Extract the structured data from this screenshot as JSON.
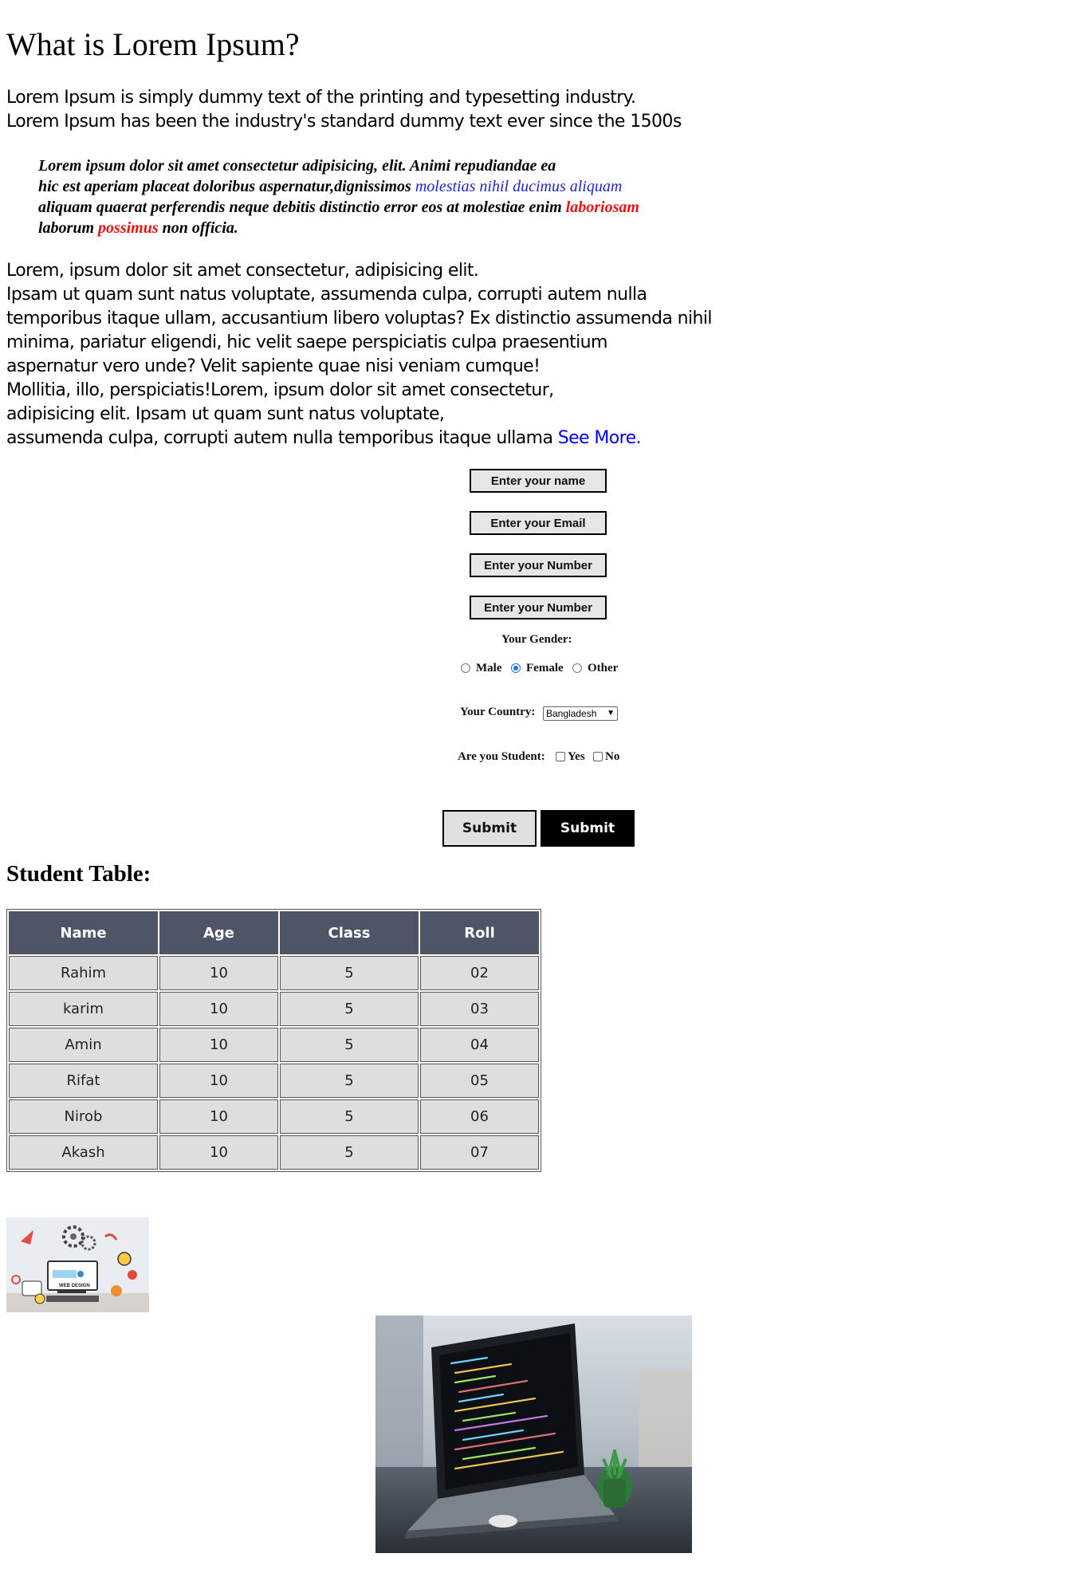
{
  "heading": "What is Lorem Ipsum?",
  "intro": {
    "line1": "Lorem Ipsum is simply dummy text of the printing and typesetting industry.",
    "line2": "Lorem Ipsum has been the industry's standard dummy text ever since the 1500s"
  },
  "quote": {
    "part1": "Lorem ipsum dolor sit amet consectetur adipisicing, elit. Animi repudiandae ea",
    "part2": "hic est aperiam placeat doloribus aspernatur,dignissimos ",
    "blue": "molestias nihil ducimus aliquam",
    "part3": "aliquam quaerat perferendis neque debitis distinctio error eos at molestiae enim ",
    "red1": "laboriosam",
    "part4": "laborum ",
    "red2": "possimus",
    "part5": " non officia."
  },
  "body": {
    "lines": [
      "Lorem, ipsum dolor sit amet consectetur, adipisicing elit.",
      "Ipsam ut quam sunt natus voluptate, assumenda culpa, corrupti autem nulla",
      "temporibus itaque ullam, accusantium libero voluptas? Ex distinctio assumenda nihil",
      "minima, pariatur eligendi, hic velit saepe perspiciatis culpa praesentium",
      "aspernatur vero unde? Velit sapiente quae nisi veniam cumque!",
      "Mollitia, illo, perspiciatis!Lorem, ipsum dolor sit amet consectetur,",
      "adipisicing elit. Ipsam ut quam sunt natus voluptate,"
    ],
    "last_line": "assumenda culpa, corrupti autem nulla temporibus itaque ullama ",
    "see_more": "See More."
  },
  "form": {
    "name_placeholder": "Enter your name",
    "email_placeholder": "Enter your Email",
    "number_placeholder": "Enter your Number",
    "number2_placeholder": "Enter your Number",
    "gender_label": "Your Gender:",
    "gender_options": [
      "Male",
      "Female",
      "Other"
    ],
    "gender_selected": "Female",
    "country_label": "Your Country:",
    "country_value": "Bangladesh",
    "student_label": "Are you Student:",
    "student_options": [
      "Yes",
      "No"
    ],
    "submit_label": "Submit",
    "submit2_label": "Submit"
  },
  "table": {
    "title": "Student Table:",
    "headers": [
      "Name",
      "Age",
      "Class",
      "Roll"
    ],
    "rows": [
      [
        "Rahim",
        "10",
        "5",
        "02"
      ],
      [
        "karim",
        "10",
        "5",
        "03"
      ],
      [
        "Amin",
        "10",
        "5",
        "04"
      ],
      [
        "Rifat",
        "10",
        "5",
        "05"
      ],
      [
        "Nirob",
        "10",
        "5",
        "06"
      ],
      [
        "Akash",
        "10",
        "5",
        "07"
      ]
    ]
  },
  "images": {
    "web_design_text": "WEB DESIGN"
  },
  "colors": {
    "link": "#0000ee",
    "quote_blue": "#2323cc",
    "quote_red": "#ee1111",
    "table_header": "#4d5566",
    "table_cell": "#dedede",
    "radio_selected": "#1a73e8"
  }
}
